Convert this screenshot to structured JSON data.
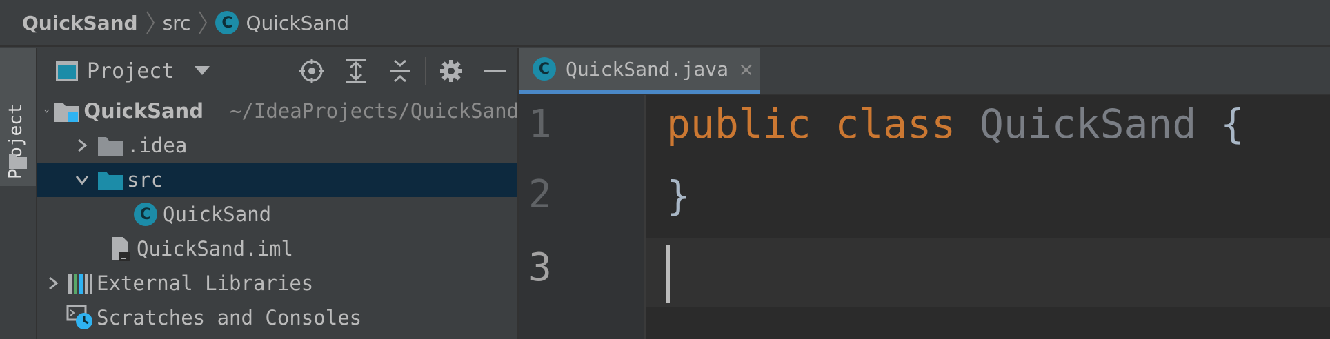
{
  "breadcrumb": {
    "items": [
      {
        "label": "QuickSand"
      },
      {
        "label": "src"
      },
      {
        "label": "QuickSand",
        "icon": "class-icon"
      }
    ]
  },
  "toolstrip": {
    "project_tab": "Project"
  },
  "project_panel": {
    "title": "Project",
    "header_icons": [
      "locate-icon",
      "expand-all-icon",
      "collapse-all-icon",
      "gear-icon",
      "hide-icon"
    ],
    "tree": [
      {
        "label": "QuickSand",
        "hint": "~/IdeaProjects/QuickSand",
        "icon": "module-folder-icon",
        "expanded": true
      },
      {
        "label": ".idea",
        "icon": "folder-icon",
        "expanded": false
      },
      {
        "label": "src",
        "icon": "source-folder-icon",
        "expanded": true,
        "selected": true
      },
      {
        "label": "QuickSand",
        "icon": "class-icon"
      },
      {
        "label": "QuickSand.iml",
        "icon": "iml-file-icon"
      },
      {
        "label": "External Libraries",
        "icon": "libraries-icon",
        "expanded": false
      },
      {
        "label": "Scratches and Consoles",
        "icon": "scratches-icon"
      }
    ]
  },
  "editor": {
    "tab": {
      "label": "QuickSand.java",
      "close": "×"
    },
    "lines": [
      {
        "number": "1",
        "keyword1": "public",
        "keyword2": "class",
        "class_name": "QuickSand",
        "brace": "{"
      },
      {
        "number": "2",
        "brace": "}"
      },
      {
        "number": "3"
      }
    ]
  },
  "colors": {
    "keyword": "#cc7832",
    "class_icon": "#1c8ca8",
    "selection": "#0d293e",
    "tab_underline": "#4a88c7"
  }
}
